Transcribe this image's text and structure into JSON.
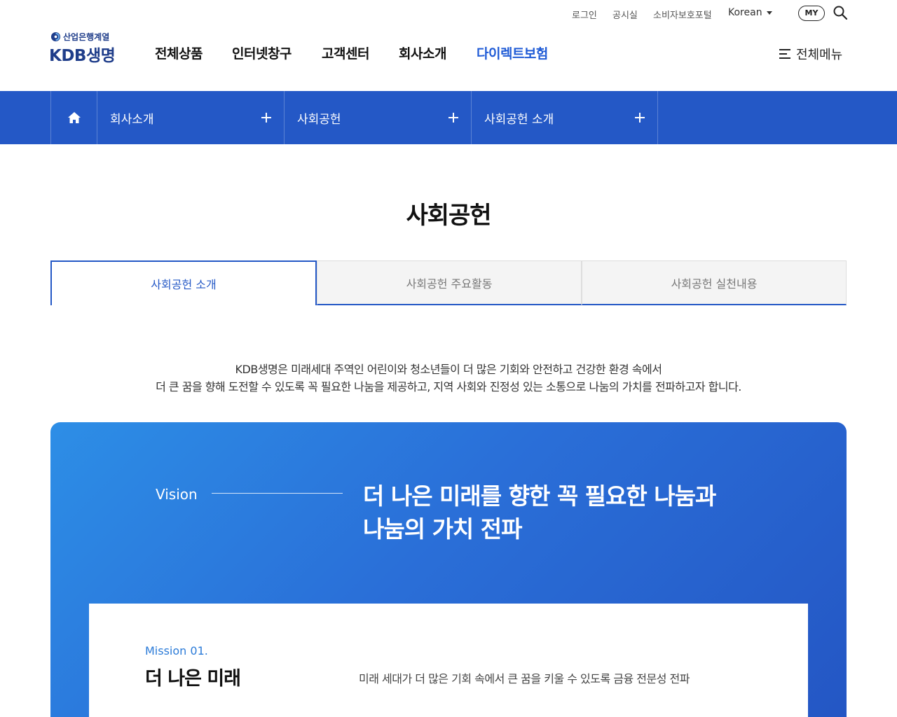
{
  "utility": {
    "login": "로그인",
    "notice": "공시실",
    "consumer_portal": "소비자보호포털",
    "language": "Korean",
    "my": "MY"
  },
  "logo": {
    "sub": "산업은행계열",
    "main": "KDB생명"
  },
  "gnb": [
    "전체상품",
    "인터넷창구",
    "고객센터",
    "회사소개",
    "다이렉트보험"
  ],
  "gnb_active_index": 4,
  "all_menu": "전체메뉴",
  "location": [
    "회사소개",
    "사회공헌",
    "사회공헌 소개"
  ],
  "page_title": "사회공헌",
  "tabs": [
    "사회공헌 소개",
    "사회공헌 주요활동",
    "사회공헌 실천내용"
  ],
  "active_tab": 0,
  "intro": {
    "line1": "KDB생명은 미래세대 주역인 어린이와 청소년들이 더 많은 기회와 안전하고 건강한 환경 속에서",
    "line2": "더 큰 꿈을 향해 도전할 수 있도록 꼭 필요한 나눔을 제공하고, 지역 사회와 진정성 있는 소통으로 나눔의 가치를 전파하고자 합니다."
  },
  "vision": {
    "label": "Vision",
    "line1": "더 나은 미래를 향한 꼭 필요한 나눔과",
    "line2": "나눔의 가치 전파"
  },
  "mission": {
    "number": "Mission 01.",
    "title": "더 나은 미래",
    "desc": "미래 세대가 더 많은 기회 속에서 큰 꿈을 키울 수 있도록 금융 전문성 전파"
  },
  "colors": {
    "primary": "#2458c6",
    "brand": "#1f3d8a",
    "accent": "#2b7bd8"
  }
}
